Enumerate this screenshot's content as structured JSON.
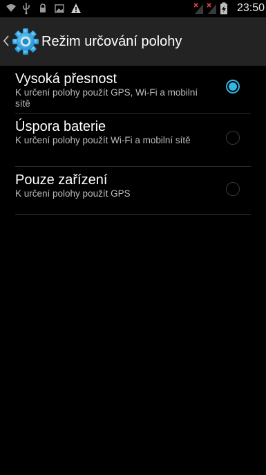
{
  "status_bar": {
    "time": "23:50",
    "icons": [
      "wifi-icon",
      "usb-icon",
      "lock-icon",
      "image-icon",
      "warning-icon",
      "signal-no-sim-1-icon",
      "signal-no-sim-2-icon",
      "battery-charging-icon"
    ]
  },
  "action_bar": {
    "title": "Režim určování polohy",
    "icon": "settings-gear-icon"
  },
  "options": [
    {
      "title": "Vysoká přesnost",
      "summary": "K určení polohy použít GPS, Wi-Fi a mobilní sítě",
      "selected": true
    },
    {
      "title": "Úspora baterie",
      "summary": "K určení polohy použít Wi-Fi a mobilní sítě",
      "selected": false
    },
    {
      "title": "Pouze zařízení",
      "summary": "K určení polohy použít GPS",
      "selected": false
    }
  ],
  "colors": {
    "accent": "#33b5e5",
    "action_bar_bg": "#232323",
    "background": "#000000"
  }
}
